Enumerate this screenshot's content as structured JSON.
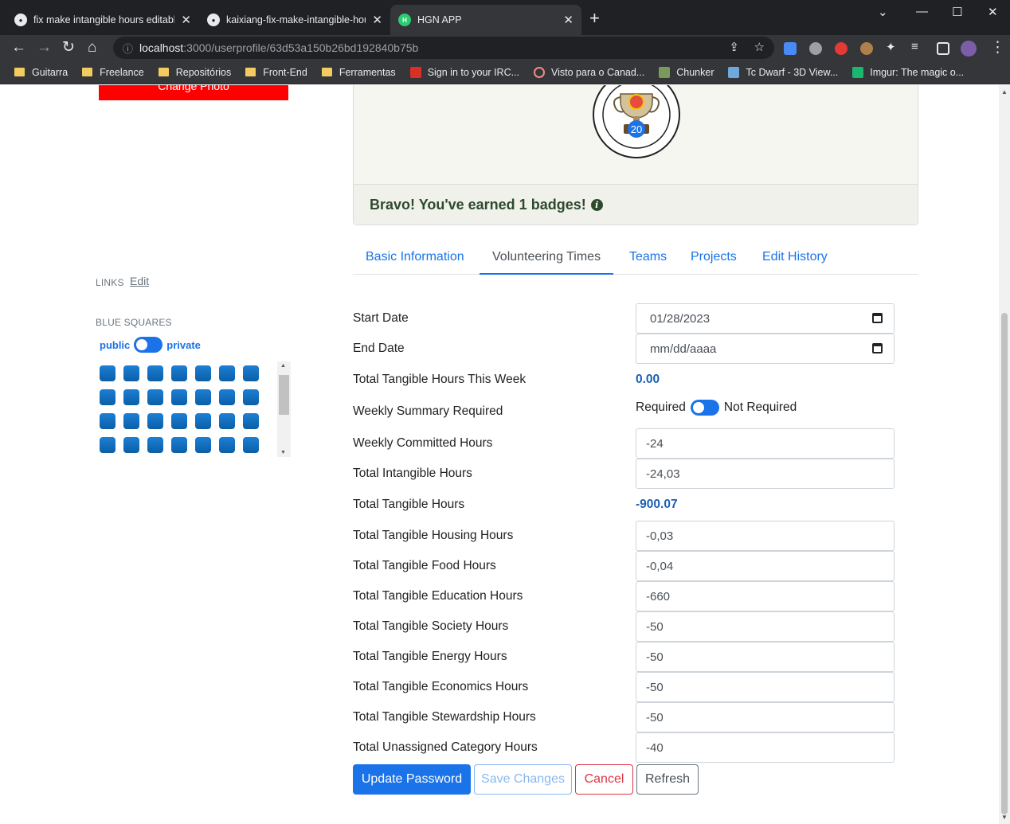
{
  "browser": {
    "tabs": [
      {
        "title": "fix make intangible hours editable",
        "active": false
      },
      {
        "title": "kaixiang-fix-make-intangible-hours",
        "active": false
      },
      {
        "title": "HGN APP",
        "active": true
      }
    ],
    "url_host": "localhost",
    "url_path": ":3000/userprofile/63d53a150b26bd192840b75b",
    "bookmarks": [
      "Guitarra",
      "Freelance",
      "Repositórios",
      "Front-End",
      "Ferramentas",
      "Sign in to your IRC...",
      "Visto para o Canad...",
      "Chunker",
      "Tc Dwarf - 3D View...",
      "Imgur: The magic o..."
    ]
  },
  "left": {
    "change_photo": "Change Photo",
    "links_label": "LINKS",
    "links_edit": "Edit",
    "blue_squares_label": "BLUE SQUARES",
    "public_label": "public",
    "private_label": "private"
  },
  "badges": {
    "badge_number": "20",
    "badge_ring_text": "NEW PERSONAL MAXIMUM FOR TANGIBLE HOURS LOGGED",
    "message": "Bravo! You've earned 1 badges!"
  },
  "tabs": [
    "Basic Information",
    "Volunteering Times",
    "Teams",
    "Projects",
    "Edit History"
  ],
  "form": {
    "start_date_label": "Start Date",
    "start_date_value": "01/28/2023",
    "end_date_label": "End Date",
    "end_date_placeholder": "mm/dd/aaaa",
    "week_tangible_label": "Total Tangible Hours This Week",
    "week_tangible_value": "0.00",
    "summary_required_label": "Weekly Summary Required",
    "required_text": "Required",
    "not_required_text": "Not Required",
    "committed_label": "Weekly Committed Hours",
    "committed_value": "-24",
    "intangible_label": "Total Intangible Hours",
    "intangible_value": "-24,03",
    "tangible_label": "Total Tangible Hours",
    "tangible_value": "-900.07",
    "categories": [
      {
        "label": "Total Tangible Housing Hours",
        "value": "-0,03"
      },
      {
        "label": "Total Tangible Food Hours",
        "value": "-0,04"
      },
      {
        "label": "Total Tangible Education Hours",
        "value": "-660"
      },
      {
        "label": "Total Tangible Society Hours",
        "value": "-50"
      },
      {
        "label": "Total Tangible Energy Hours",
        "value": "-50"
      },
      {
        "label": "Total Tangible Economics Hours",
        "value": "-50"
      },
      {
        "label": "Total Tangible Stewardship Hours",
        "value": "-50"
      },
      {
        "label": "Total Unassigned Category Hours",
        "value": "-40"
      }
    ]
  },
  "buttons": {
    "update_password": "Update Password",
    "save_changes": "Save Changes",
    "cancel": "Cancel",
    "refresh": "Refresh"
  }
}
